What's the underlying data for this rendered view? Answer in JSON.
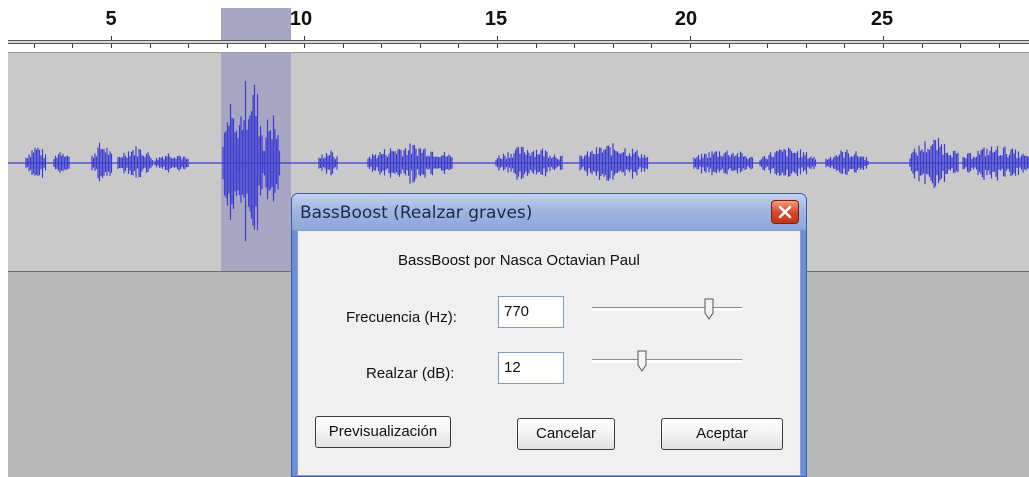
{
  "timeline": {
    "tick_labels": [
      "5",
      "10",
      "15",
      "20",
      "25"
    ]
  },
  "dialog": {
    "title": "BassBoost (Realzar graves)",
    "close_icon": "close-icon",
    "author_text": "BassBoost por Nasca Octavian Paul",
    "frequency": {
      "label": "Frecuencia (Hz):",
      "value": "770",
      "slider_level_fraction": 0.78
    },
    "boost": {
      "label": "Realzar (dB):",
      "value": "12",
      "slider_level_fraction": 0.33
    },
    "buttons": {
      "preview": "Previsualización",
      "cancel": "Cancelar",
      "ok": "Aceptar"
    }
  },
  "colors": {
    "waveform": "#3c3cd2",
    "selection": "#a7a7c3",
    "track_background": "#c9c9c9",
    "titlebar": "#9fb5e2",
    "close_button": "#d8452a"
  }
}
